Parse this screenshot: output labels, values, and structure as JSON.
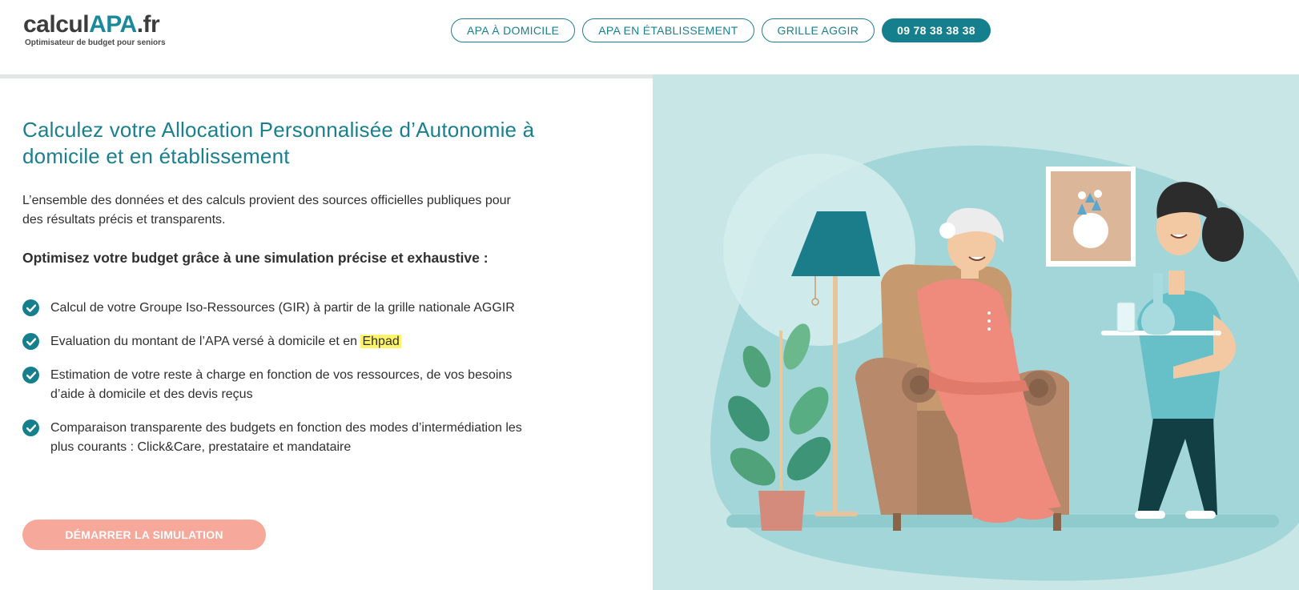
{
  "header": {
    "logo": {
      "part1": "calcul",
      "part2": "APA",
      "part3": ".fr",
      "tagline": "Optimisateur de budget pour seniors"
    },
    "nav": [
      {
        "label": "APA À DOMICILE"
      },
      {
        "label": "APA EN ÉTABLISSEMENT"
      },
      {
        "label": "GRILLE AGGIR"
      }
    ],
    "phone": "09 78 38 38 38"
  },
  "hero": {
    "title": "Calculez votre Allocation Personnalisée d’Autonomie à domicile et en établissement",
    "intro": "L’ensemble des données et des calculs provient des sources officielles publiques pour des résultats précis et transparents.",
    "subtitle": "Optimisez votre budget grâce à une simulation précise et exhaustive :",
    "features": [
      {
        "text": "Calcul de votre Groupe Iso-Ressources (GIR) à partir de la grille nationale AGGIR"
      },
      {
        "text_before": "Evaluation du montant de l’APA versé à domicile et en ",
        "highlight": "Ehpad"
      },
      {
        "text": "Estimation de votre reste à charge en fonction de vos ressources, de vos besoins d’aide à domicile et des devis reçus"
      },
      {
        "text": "Comparaison transparente des budgets en fonction des modes d’intermédiation les plus courants : Click&Care, prestataire et mandataire"
      }
    ],
    "cta": "DÉMARRER LA SIMULATION"
  },
  "illustration": {
    "icon": "senior-care-illustration",
    "colors": {
      "background": "#c9e6e6",
      "accent": "#157f8d",
      "cta": "#f6a89a",
      "highlight": "#fff36a"
    }
  }
}
